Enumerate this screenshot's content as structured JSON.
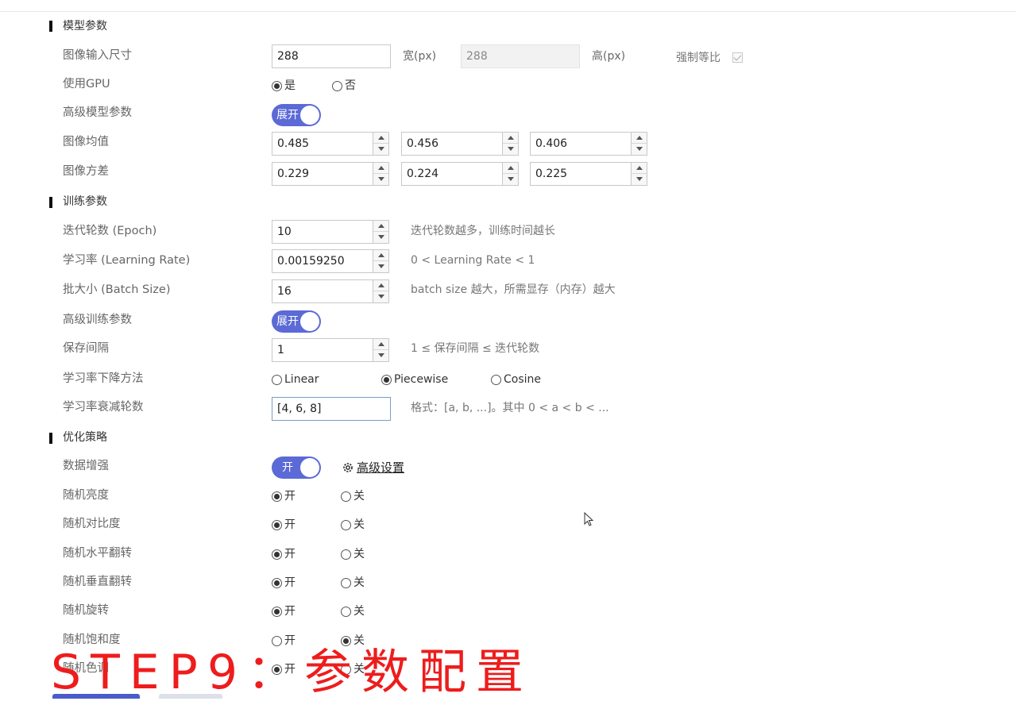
{
  "model_section": {
    "title": "模型参数",
    "image_size": {
      "label": "图像输入尺寸",
      "width_value": "288",
      "width_unit": "宽(px)",
      "height_value": "288",
      "height_unit": "高(px)",
      "lock_ratio_label": "强制等比",
      "lock_ratio_checked": true
    },
    "use_gpu": {
      "label": "使用GPU",
      "options": [
        "是",
        "否"
      ],
      "selected": "是"
    },
    "advanced_model": {
      "label": "高级模型参数",
      "toggle_label": "展开"
    },
    "image_mean": {
      "label": "图像均值",
      "values": [
        "0.485",
        "0.456",
        "0.406"
      ]
    },
    "image_std": {
      "label": "图像方差",
      "values": [
        "0.229",
        "0.224",
        "0.225"
      ]
    }
  },
  "train_section": {
    "title": "训练参数",
    "epoch": {
      "label": "迭代轮数 (Epoch)",
      "value": "10",
      "hint": "迭代轮数越多，训练时间越长"
    },
    "learning_rate": {
      "label": "学习率 (Learning Rate)",
      "value": "0.00159250",
      "hint": "0 < Learning Rate < 1"
    },
    "batch_size": {
      "label": "批大小 (Batch Size)",
      "value": "16",
      "hint": "batch size 越大，所需显存（内存）越大"
    },
    "advanced_train": {
      "label": "高级训练参数",
      "toggle_label": "展开"
    },
    "save_interval": {
      "label": "保存间隔",
      "value": "1",
      "hint": "1 ≤ 保存间隔 ≤ 迭代轮数"
    },
    "lr_decay_method": {
      "label": "学习率下降方法",
      "options": [
        "Linear",
        "Piecewise",
        "Cosine"
      ],
      "selected": "Piecewise"
    },
    "lr_decay_epochs": {
      "label": "学习率衰减轮数",
      "value": "[4, 6, 8]",
      "hint": "格式：[a, b, ...]。其中 0 < a < b < ..."
    }
  },
  "opt_section": {
    "title": "优化策略",
    "augment": {
      "label": "数据增强",
      "toggle_label": "开",
      "advanced_link": "高级设置"
    },
    "switches": [
      {
        "label": "随机亮度",
        "on_label": "开",
        "off_label": "关",
        "selected": "on"
      },
      {
        "label": "随机对比度",
        "on_label": "开",
        "off_label": "关",
        "selected": "on"
      },
      {
        "label": "随机水平翻转",
        "on_label": "开",
        "off_label": "关",
        "selected": "on"
      },
      {
        "label": "随机垂直翻转",
        "on_label": "开",
        "off_label": "关",
        "selected": "on"
      },
      {
        "label": "随机旋转",
        "on_label": "开",
        "off_label": "关",
        "selected": "on"
      },
      {
        "label": "随机饱和度",
        "on_label": "开",
        "off_label": "关",
        "selected": "off"
      },
      {
        "label": "随机色调",
        "on_label": "开",
        "off_label": "关",
        "selected": "on"
      }
    ]
  },
  "overlay_caption": "STEP9：参数配置",
  "colors": {
    "toggle_bg": "#5b6ad6",
    "caption": "#ee1c1c",
    "bottom_primary": "#4a5cc9"
  }
}
